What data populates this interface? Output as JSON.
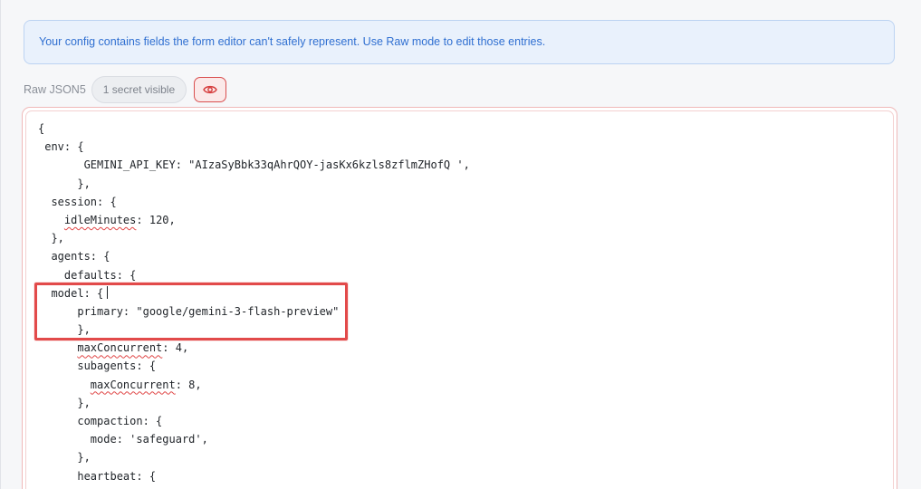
{
  "notice": {
    "text": "Your config contains fields the form editor can't safely represent. Use Raw mode to edit those entries."
  },
  "toolbar": {
    "mode_label": "Raw JSON5",
    "secret_badge": "1 secret visible",
    "eye_icon": "eye-icon"
  },
  "editor": {
    "lines": [
      {
        "indent": "",
        "key": "",
        "text": "{"
      },
      {
        "indent": " ",
        "key": "",
        "text": "env: {"
      },
      {
        "indent": "       ",
        "key": "",
        "text": "GEMINI_API_KEY: \"AIzaSyBbk33qAhrQOY-jasKx6kzls8zflmZHofQ ',"
      },
      {
        "indent": "      ",
        "key": "",
        "text": "},"
      },
      {
        "indent": "  ",
        "key": "",
        "text": "session: {"
      },
      {
        "indent": "    ",
        "key": "idleMinutes",
        "text": ": 120,"
      },
      {
        "indent": "  ",
        "key": "",
        "text": "},"
      },
      {
        "indent": "  ",
        "key": "",
        "text": "agents: {"
      },
      {
        "indent": "    ",
        "key": "",
        "text": "defaults: {"
      },
      {
        "indent": "  ",
        "key": "",
        "text": "model: {",
        "caret": true
      },
      {
        "indent": "      ",
        "key": "",
        "text": "primary: \"google/gemini-3-flash-preview\""
      },
      {
        "indent": "      ",
        "key": "",
        "text": "},"
      },
      {
        "indent": "      ",
        "key": "maxConcurrent",
        "text": ": 4,"
      },
      {
        "indent": "      ",
        "key": "",
        "text": "subagents: {"
      },
      {
        "indent": "        ",
        "key": "maxConcurrent",
        "text": ": 8,"
      },
      {
        "indent": "      ",
        "key": "",
        "text": "},"
      },
      {
        "indent": "      ",
        "key": "",
        "text": "compaction: {"
      },
      {
        "indent": "        ",
        "key": "",
        "text": "mode: 'safeguard',"
      },
      {
        "indent": "      ",
        "key": "",
        "text": "},"
      },
      {
        "indent": "      ",
        "key": "",
        "text": "heartbeat: {"
      }
    ]
  },
  "colors": {
    "accent_blue": "#2f6fd1",
    "alert_red": "#e24a4a"
  }
}
